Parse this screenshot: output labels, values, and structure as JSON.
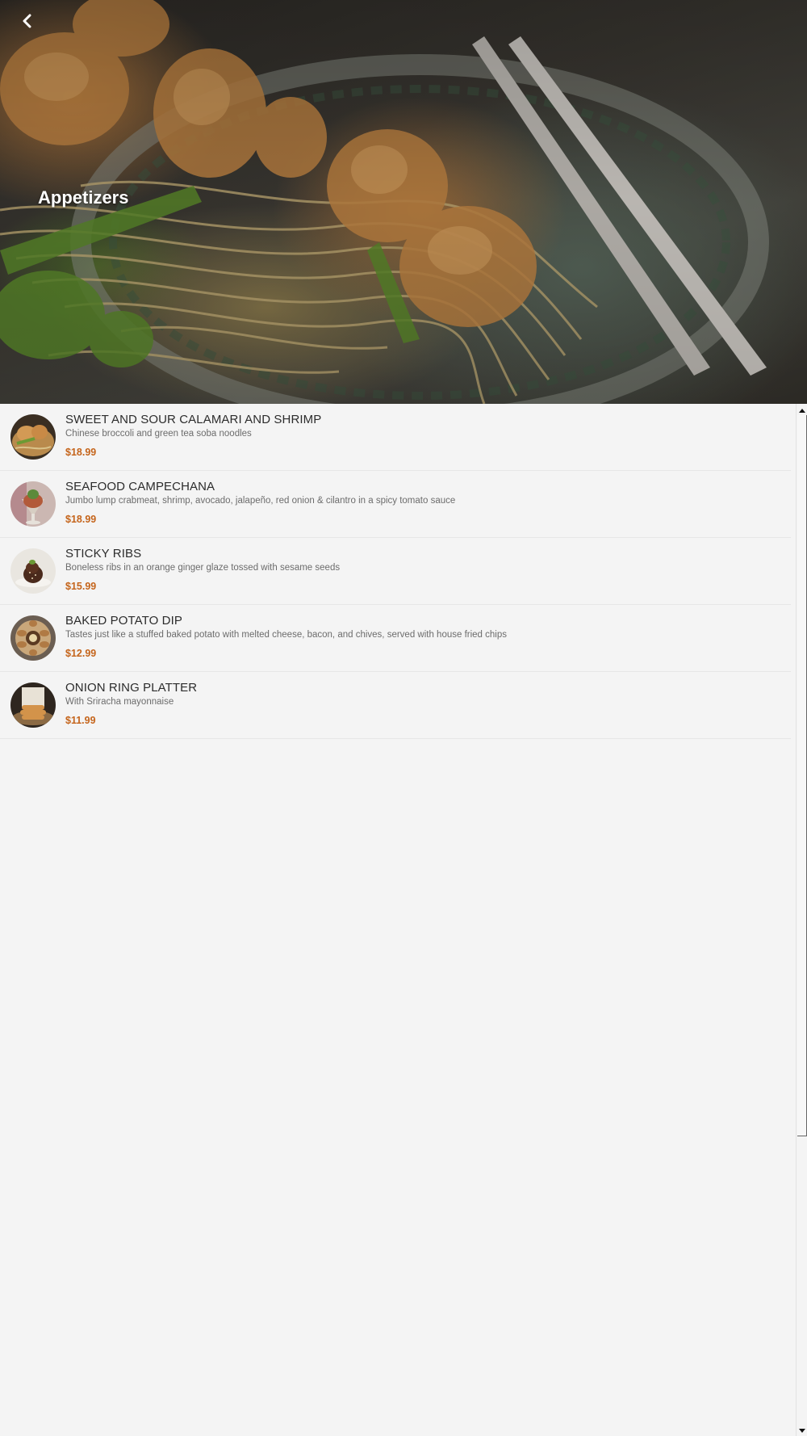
{
  "header": {
    "title": "Appetizers",
    "back_icon": "chevron-left-icon"
  },
  "menu": {
    "items": [
      {
        "name": "SWEET AND SOUR CALAMARI AND SHRIMP",
        "description": "Chinese broccoli and green tea soba noodles",
        "price": "$18.99"
      },
      {
        "name": "SEAFOOD CAMPECHANA",
        "description": "Jumbo lump crabmeat, shrimp, avocado, jalapeño, red onion & cilantro in a spicy tomato sauce",
        "price": "$18.99"
      },
      {
        "name": "STICKY RIBS",
        "description": "Boneless ribs in an orange ginger glaze tossed with sesame seeds",
        "price": "$15.99"
      },
      {
        "name": "BAKED POTATO DIP",
        "description": "Tastes just like a stuffed baked potato with melted cheese, bacon, and chives, served with house fried chips",
        "price": "$12.99"
      },
      {
        "name": "ONION RING PLATTER",
        "description": "With Sriracha mayonnaise",
        "price": "$11.99"
      }
    ]
  },
  "colors": {
    "price": "#c5651c",
    "background": "#f4f4f4",
    "title_text": "#ffffff"
  }
}
